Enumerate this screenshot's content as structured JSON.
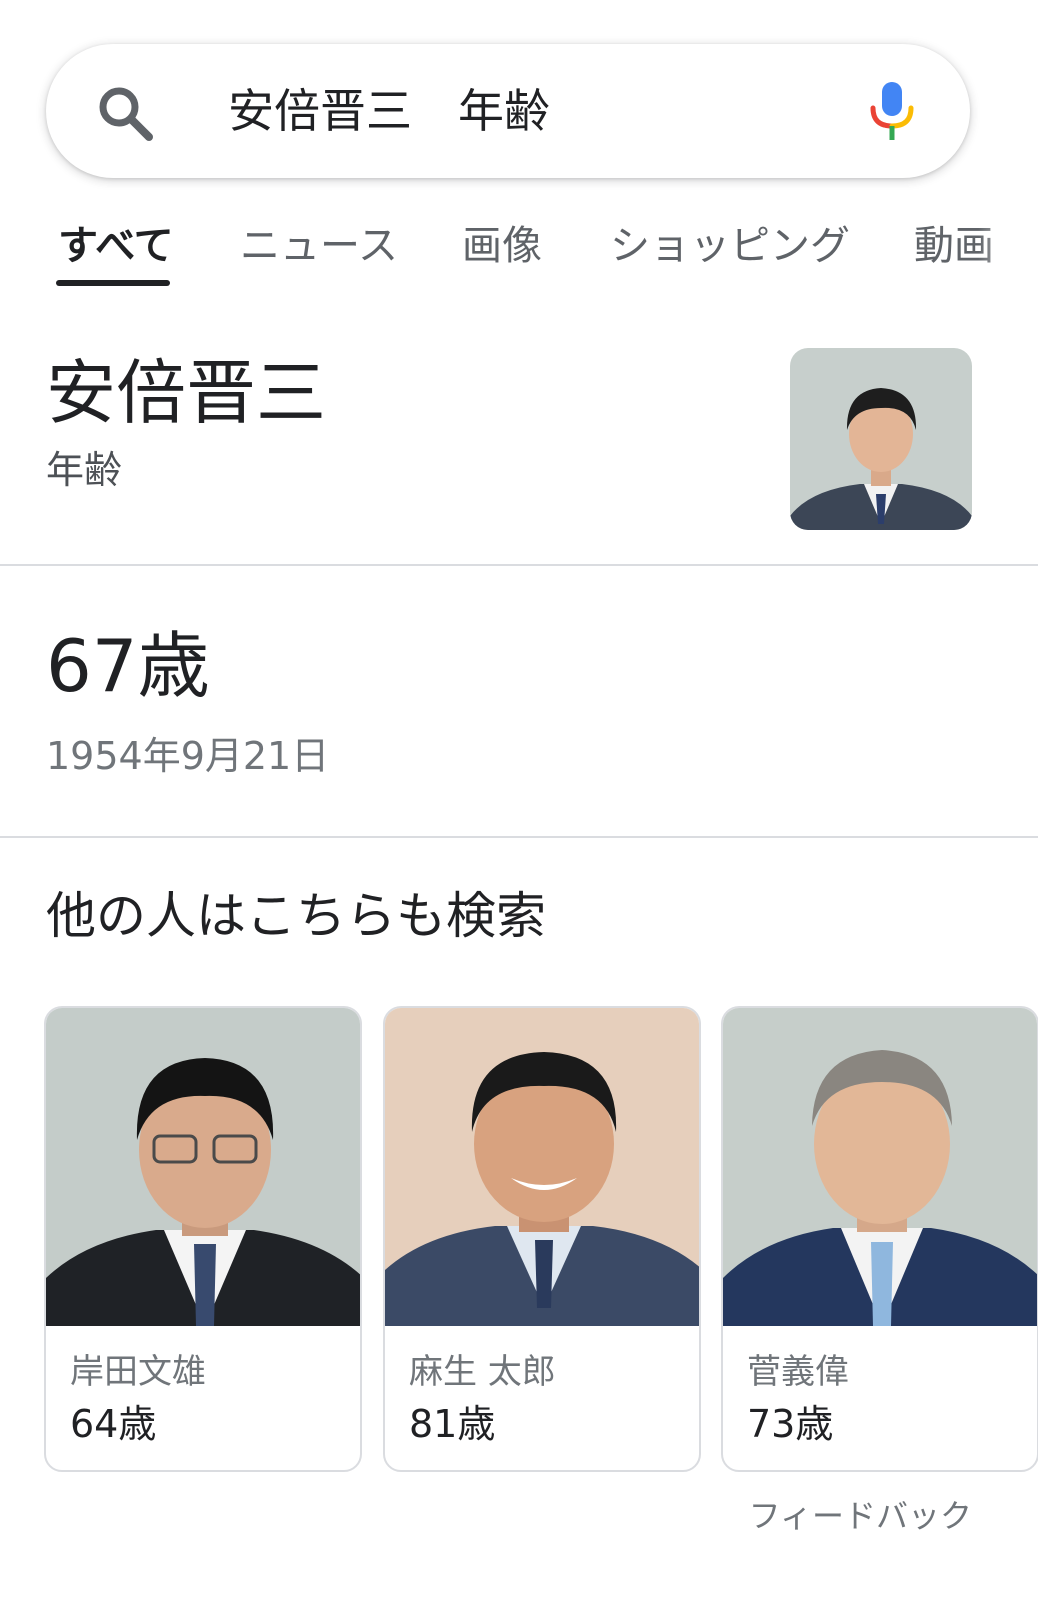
{
  "search": {
    "query": "安倍晋三　年齢",
    "search_icon": "search-icon",
    "mic_icon": "microphone-icon"
  },
  "tabs": [
    {
      "label": "すべて",
      "active": true
    },
    {
      "label": "ニュース",
      "active": false
    },
    {
      "label": "画像",
      "active": false
    },
    {
      "label": "ショッピング",
      "active": false
    },
    {
      "label": "動画",
      "active": false
    }
  ],
  "entity": {
    "name": "安倍晋三",
    "attribute": "年齢",
    "photo": "person-portrait"
  },
  "answer": {
    "age": "67歳",
    "birth_date": "1954年9月21日"
  },
  "people_also_search": {
    "title": "他の人はこちらも検索",
    "items": [
      {
        "name": "岸田文雄",
        "age": "64歳"
      },
      {
        "name": "麻生 太郎",
        "age": "81歳"
      },
      {
        "name": "菅義偉",
        "age": "73歳"
      }
    ]
  },
  "feedback_label": "フィードバック",
  "colors": {
    "text_primary": "#202124",
    "text_secondary": "#70757a",
    "divider": "#dadce0",
    "mic_blue": "#4285f4",
    "mic_red": "#ea4335",
    "mic_yellow": "#fbbc05",
    "mic_green": "#34a853"
  }
}
